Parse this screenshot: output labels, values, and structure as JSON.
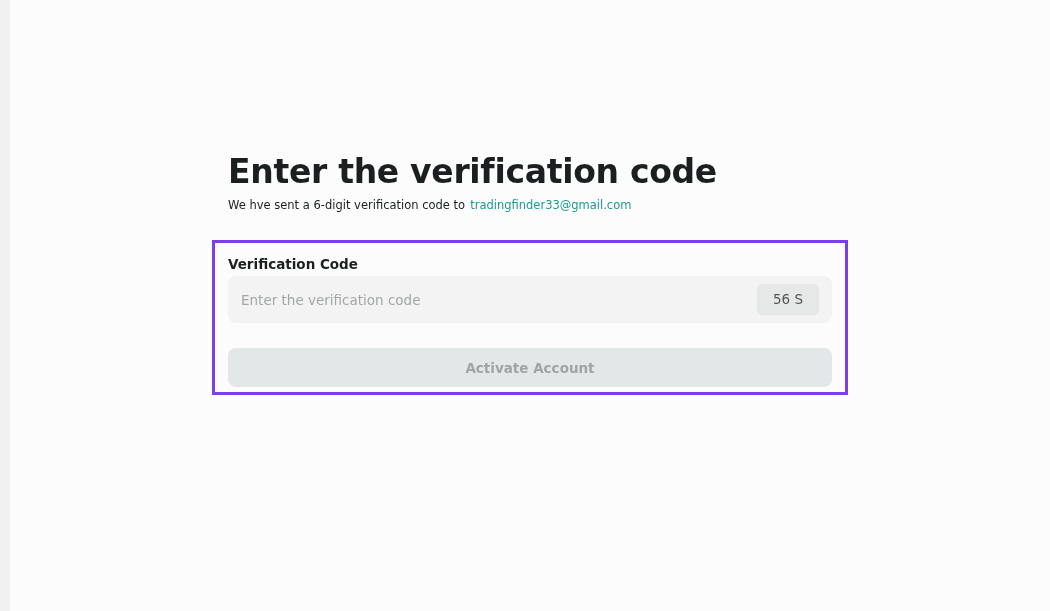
{
  "title": "Enter the verification code",
  "subtitle": {
    "text": "We hve sent a 6-digit verification code to",
    "email": "tradingfinder33@gmail.com"
  },
  "form": {
    "highlighted": true,
    "label": "Verification Code",
    "field": {
      "placeholder": "Enter the verification code",
      "timer": "56 S"
    },
    "button": {
      "label": "Activate Account",
      "disabled": true
    }
  }
}
